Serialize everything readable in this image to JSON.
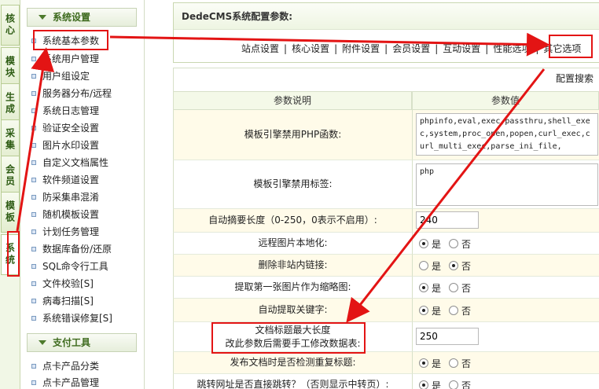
{
  "left_tabs": [
    "核心",
    "模块",
    "生成",
    "采集",
    "会员",
    "模板",
    "系统"
  ],
  "sidebar": {
    "section1": "系统设置",
    "items": [
      "系统基本参数",
      "系统用户管理",
      "用户组设定",
      "服务器分布/远程",
      "系统日志管理",
      "验证安全设置",
      "图片水印设置",
      "自定义文档属性",
      "软件频道设置",
      "防采集串混淆",
      "随机模板设置",
      "计划任务管理",
      "数据库备份/还原",
      "SQL命令行工具",
      "文件校验[S]",
      "病毒扫描[S]",
      "系统错误修复[S]"
    ],
    "section2": "支付工具",
    "items2": [
      "点卡产品分类",
      "点卡产品管理"
    ]
  },
  "main": {
    "title": "DedeCMS系统配置参数:",
    "tabs": [
      "站点设置",
      "核心设置",
      "附件设置",
      "会员设置",
      "互动设置",
      "性能选项",
      "其它选项"
    ],
    "search_hint": "配置搜索",
    "col_desc": "参数说明",
    "col_value": "参数值",
    "rows": [
      {
        "label": "模板引擎禁用PHP函数:",
        "value": "phpinfo,eval,exec,passthru,shell_exec,system,proc_open,popen,curl_exec,curl_multi_exec,parse_ini_file,"
      },
      {
        "label": "模板引擎禁用标签:",
        "value": "php"
      },
      {
        "label": "自动摘要长度（0-250，0表示不启用）:",
        "value": "240"
      },
      {
        "label": "远程图片本地化:",
        "selected": "是"
      },
      {
        "label": "删除非站内链接:",
        "selected": "否"
      },
      {
        "label": "提取第一张图片作为缩略图:",
        "selected": "是"
      },
      {
        "label": "自动提取关键字:",
        "selected": "是"
      },
      {
        "label_line1": "文档标题最大长度",
        "label_line2": "改此参数后需要手工修改数据表:",
        "value": "250"
      },
      {
        "label": "发布文档时是否检测重复标题:",
        "selected": "是"
      },
      {
        "label": "跳转网址是否直接跳转？（否则显示中转页）:",
        "selected": "是"
      }
    ],
    "radio_yes": "是",
    "radio_no": "否"
  },
  "annotation_color": "#e31414"
}
